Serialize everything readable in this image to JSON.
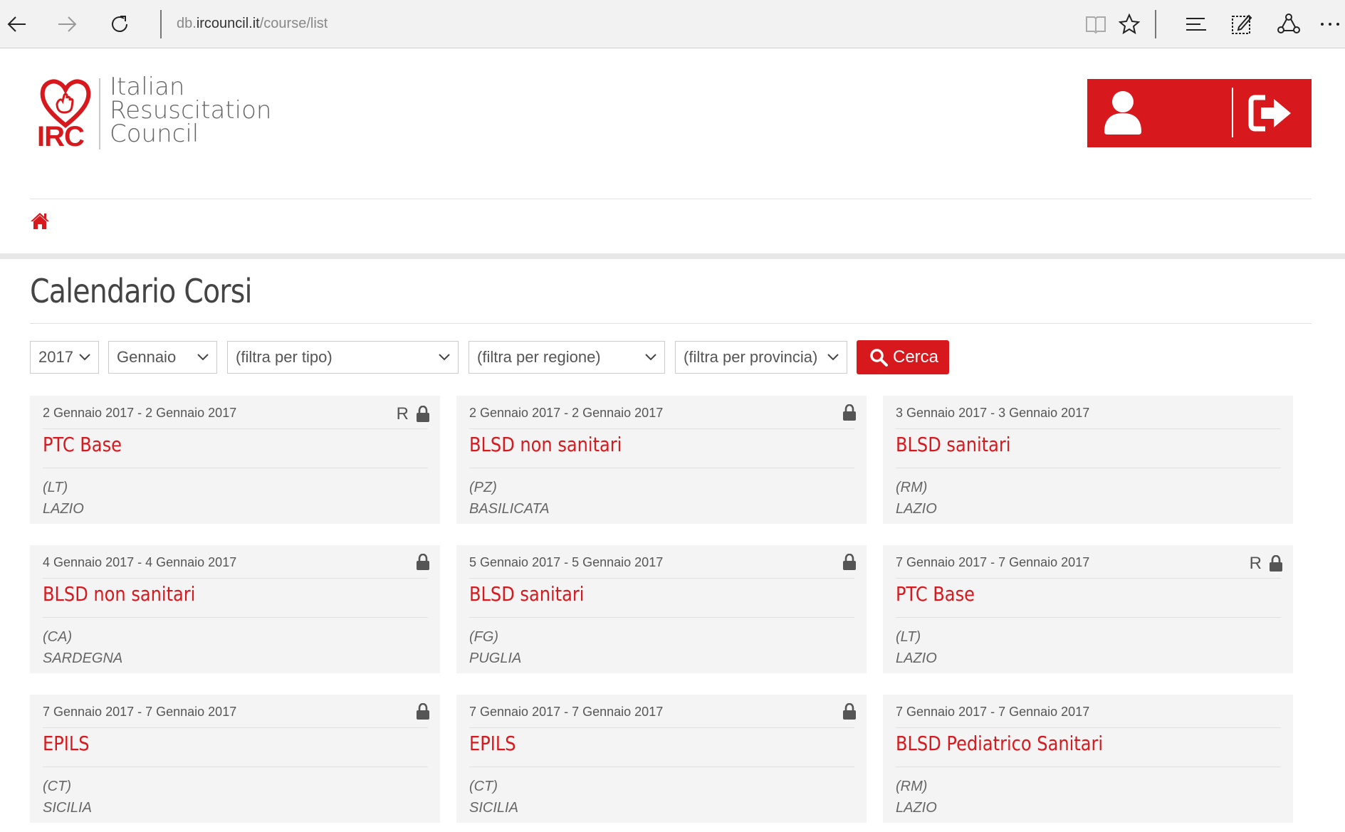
{
  "browser": {
    "url_host_prefix": "db.",
    "url_host": "ircouncil.it",
    "url_path": "/course/list"
  },
  "logo": {
    "abbr": "IRC",
    "line1": "Italian",
    "line2": "Resuscitation",
    "line3": "Council"
  },
  "page": {
    "title": "Calendario Corsi"
  },
  "filters": {
    "year": "2017",
    "month": "Gennaio",
    "type": "(filtra per tipo)",
    "region": "(filtra per regione)",
    "province": "(filtra per provincia)",
    "search_label": "Cerca"
  },
  "colors": {
    "brand_red": "#d7191e"
  },
  "courses": [
    {
      "date": "2 Gennaio 2017 - 2 Gennaio 2017",
      "badge": "R",
      "title": "PTC Base",
      "province": "(LT)",
      "region": "LAZIO"
    },
    {
      "date": "2 Gennaio 2017 - 2 Gennaio 2017",
      "badge": "",
      "title": "BLSD non sanitari",
      "province": "(PZ)",
      "region": "BASILICATA"
    },
    {
      "date": "3 Gennaio 2017 - 3 Gennaio 2017",
      "badge": "",
      "title": "BLSD sanitari",
      "province": "(RM)",
      "region": "LAZIO"
    },
    {
      "date": "4 Gennaio 2017 - 4 Gennaio 2017",
      "badge": "",
      "title": "BLSD non sanitari",
      "province": "(CA)",
      "region": "SARDEGNA"
    },
    {
      "date": "5 Gennaio 2017 - 5 Gennaio 2017",
      "badge": "",
      "title": "BLSD sanitari",
      "province": "(FG)",
      "region": "PUGLIA"
    },
    {
      "date": "7 Gennaio 2017 - 7 Gennaio 2017",
      "badge": "R",
      "title": "PTC Base",
      "province": "(LT)",
      "region": "LAZIO"
    },
    {
      "date": "7 Gennaio 2017 - 7 Gennaio 2017",
      "badge": "",
      "title": "EPILS",
      "province": "(CT)",
      "region": "SICILIA"
    },
    {
      "date": "7 Gennaio 2017 - 7 Gennaio 2017",
      "badge": "",
      "title": "EPILS",
      "province": "(CT)",
      "region": "SICILIA"
    },
    {
      "date": "7 Gennaio 2017 - 7 Gennaio 2017",
      "badge": "",
      "title": "BLSD Pediatrico Sanitari",
      "province": "(RM)",
      "region": "LAZIO"
    }
  ],
  "locked_cards": [
    true,
    true,
    false,
    true,
    true,
    true,
    true,
    true,
    false
  ]
}
